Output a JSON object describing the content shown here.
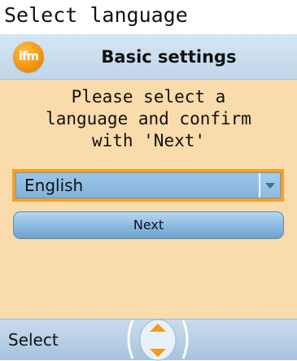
{
  "window": {
    "title": "Select language"
  },
  "header": {
    "logo_text": "ifm",
    "title": "Basic settings"
  },
  "content": {
    "instruction": "Please select a\nlanguage and confirm\nwith 'Next'",
    "language_select": {
      "selected": "English"
    },
    "next_label": "Next"
  },
  "footer": {
    "softkey_label": "Select",
    "nav_icon": "up-down-navigation-icon"
  },
  "colors": {
    "content_bg": "#fadbac",
    "header_bg": "#c1d6ea",
    "accent_orange": "#f3a028",
    "control_blue": "#88b8df"
  }
}
